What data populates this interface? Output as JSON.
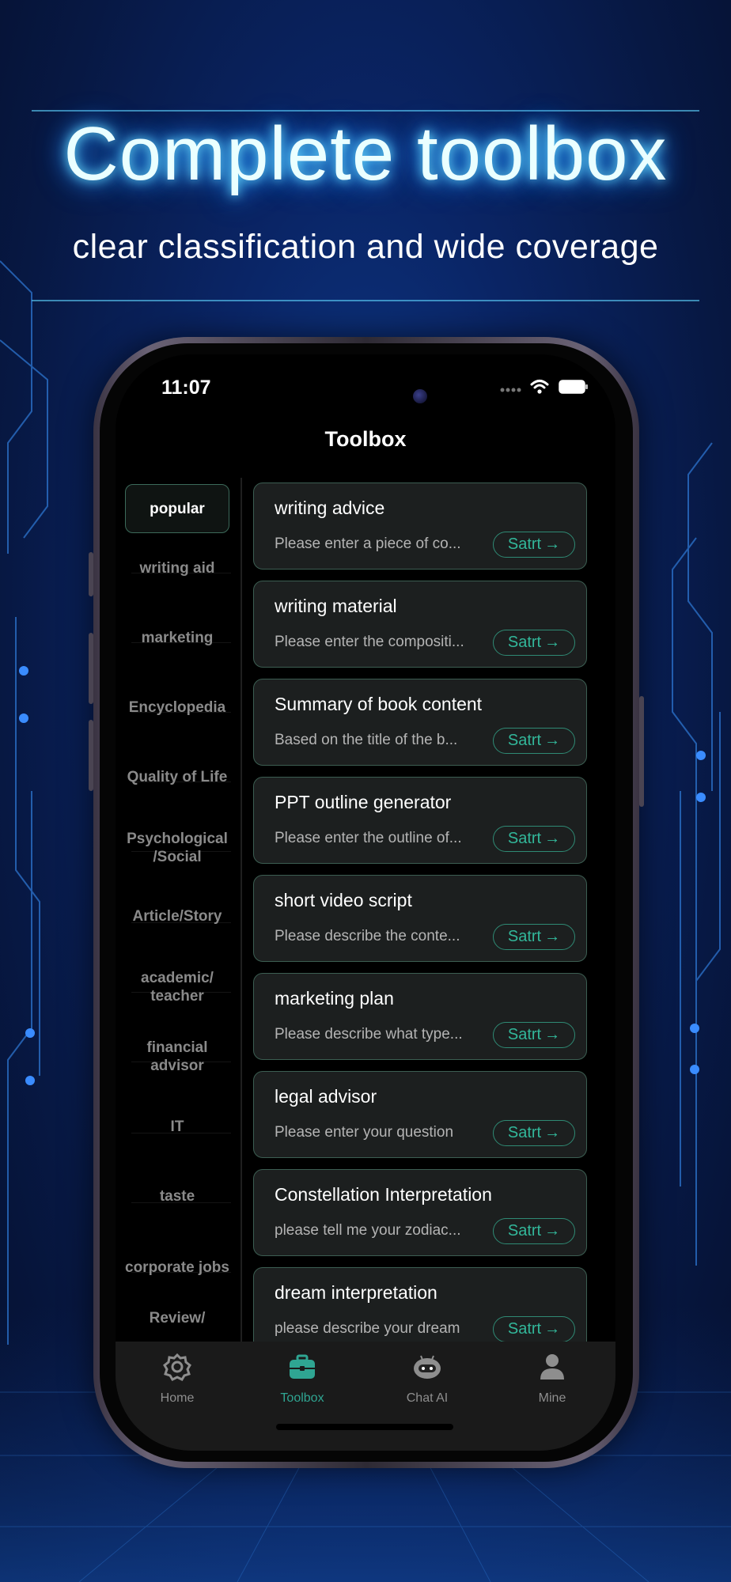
{
  "promo": {
    "headline": "Complete toolbox",
    "subline": "clear classification and wide coverage"
  },
  "status_bar": {
    "time": "11:07"
  },
  "header": {
    "title": "Toolbox"
  },
  "categories": [
    {
      "label": "popular"
    },
    {
      "label": "writing aid"
    },
    {
      "label": "marketing"
    },
    {
      "label": "Encyclopedia"
    },
    {
      "label": "Quality of Life"
    },
    {
      "label": "Psychological /Social"
    },
    {
      "label": "Article/Story"
    },
    {
      "label": "academic/ teacher"
    },
    {
      "label": "financial advisor"
    },
    {
      "label": "IT"
    },
    {
      "label": "taste"
    },
    {
      "label": "corporate jobs"
    },
    {
      "label": "Review/"
    }
  ],
  "active_category": "popular",
  "tools": [
    {
      "title": "writing advice",
      "description": "Please enter a piece of co...",
      "button": "Satrt"
    },
    {
      "title": "writing material",
      "description": "Please enter the compositi...",
      "button": "Satrt"
    },
    {
      "title": "Summary of book content",
      "description": "Based on the title of the b...",
      "button": "Satrt"
    },
    {
      "title": "PPT outline generator",
      "description": "Please enter the outline of...",
      "button": "Satrt"
    },
    {
      "title": "short video script",
      "description": "Please describe the conte...",
      "button": "Satrt"
    },
    {
      "title": "marketing plan",
      "description": "Please describe what type...",
      "button": "Satrt"
    },
    {
      "title": "legal advisor",
      "description": "Please enter your question",
      "button": "Satrt"
    },
    {
      "title": "Constellation Interpretation",
      "description": "please tell me your zodiac...",
      "button": "Satrt"
    },
    {
      "title": "dream interpretation",
      "description": "please describe your dream",
      "button": "Satrt"
    }
  ],
  "tabbar": [
    {
      "label": "Home",
      "icon": "gear-icon"
    },
    {
      "label": "Toolbox",
      "icon": "toolbox-icon"
    },
    {
      "label": "Chat AI",
      "icon": "robot-icon"
    },
    {
      "label": "Mine",
      "icon": "person-icon"
    }
  ],
  "active_tab": "Toolbox",
  "colors": {
    "accent": "#2fa592",
    "card_border": "#3c5e52",
    "card_bg": "#1c1f1f",
    "headline_glow": "#6fe3ff",
    "background": "#0a2566"
  }
}
